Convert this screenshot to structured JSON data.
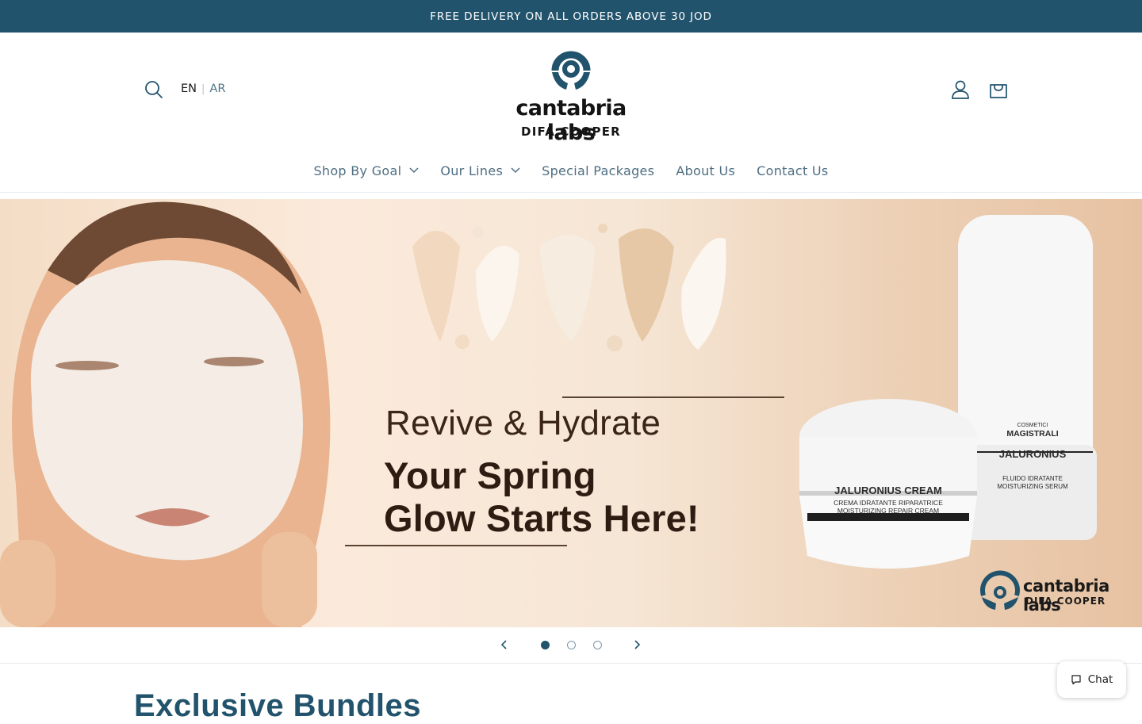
{
  "announcement": {
    "text": "FREE DELIVERY ON ALL ORDERS ABOVE 30 JOD"
  },
  "header": {
    "lang_en": "EN",
    "lang_sep": "|",
    "lang_ar": "AR",
    "logo": {
      "wordmark": "cantabria labs",
      "sub": "DIFA COOPER"
    }
  },
  "nav": {
    "items": [
      {
        "label": "Shop By Goal",
        "dropdown": true
      },
      {
        "label": "Our Lines",
        "dropdown": true
      },
      {
        "label": "Special Packages",
        "dropdown": false
      },
      {
        "label": "About Us",
        "dropdown": false
      },
      {
        "label": "Contact Us",
        "dropdown": false
      }
    ]
  },
  "hero": {
    "headline": "Revive & Hydrate",
    "tagline_line1": "Your Spring",
    "tagline_line2": "Glow Starts Here!",
    "jar": {
      "name": "JALURONIUS CREAM",
      "line1": "CREMA IDRATANTE RIPARATRICE",
      "line2": "MOISTURIZING REPAIR CREAM"
    },
    "bottle": {
      "brand_small": "COSMETICI",
      "brand": "MAGISTRALI",
      "name": "JALURONIUS",
      "line1": "FLUIDO IDRATANTE",
      "line2": "MOISTURIZING SERUM"
    },
    "brand_word": "cantabria labs",
    "brand_sub": "DIFA COOPER"
  },
  "slider": {
    "total": 3,
    "active": 1
  },
  "section": {
    "title": "Exclusive Bundles"
  },
  "chat": {
    "label": "Chat"
  },
  "colors": {
    "primary": "#22536c",
    "nav_text": "#4e6e82"
  },
  "icons": [
    "search-icon",
    "account-icon",
    "cart-icon",
    "chevron-down-icon",
    "chevron-left-icon",
    "chevron-right-icon",
    "chat-icon"
  ]
}
